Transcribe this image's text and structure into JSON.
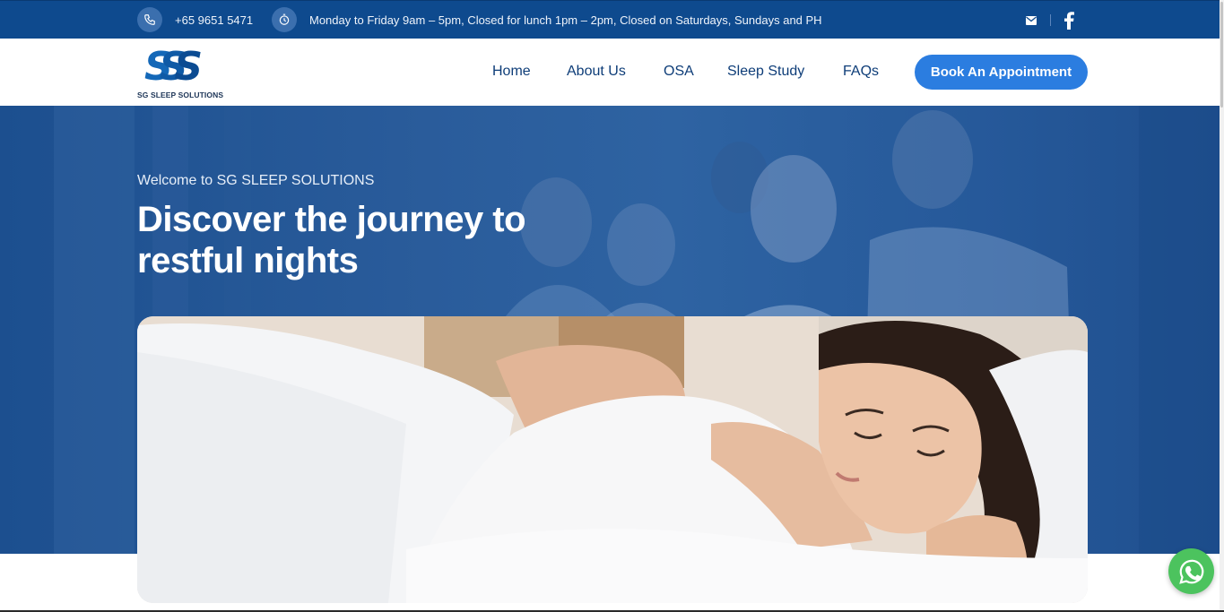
{
  "topbar": {
    "phone": "+65 9651 5471",
    "hours": "Monday to Friday 9am – 5pm, Closed for lunch 1pm – 2pm, Closed on Saturdays, Sundays and PH",
    "phone_icon": "phone-icon",
    "hours_icon": "clock-icon",
    "mail_icon": "mail-icon",
    "facebook_icon": "facebook-icon"
  },
  "header": {
    "logo_text": "SG SLEEP SOLUTIONS",
    "nav": {
      "home": "Home",
      "about": "About Us",
      "osa": "OSA",
      "sleep_study": "Sleep Study",
      "faqs": "FAQs"
    },
    "cta_label": "Book An Appointment"
  },
  "hero": {
    "welcome": "Welcome to SG SLEEP SOLUTIONS",
    "headline_line1": "Discover the journey to",
    "headline_line2": "restful nights"
  },
  "colors": {
    "topbar_bg": "#0e4a8e",
    "nav_text": "#0e3d78",
    "cta_bg": "#2b7de0",
    "hero_overlay": "#2a5c9b",
    "whatsapp": "#4cc35e"
  },
  "floating": {
    "whatsapp_icon": "whatsapp-icon"
  }
}
